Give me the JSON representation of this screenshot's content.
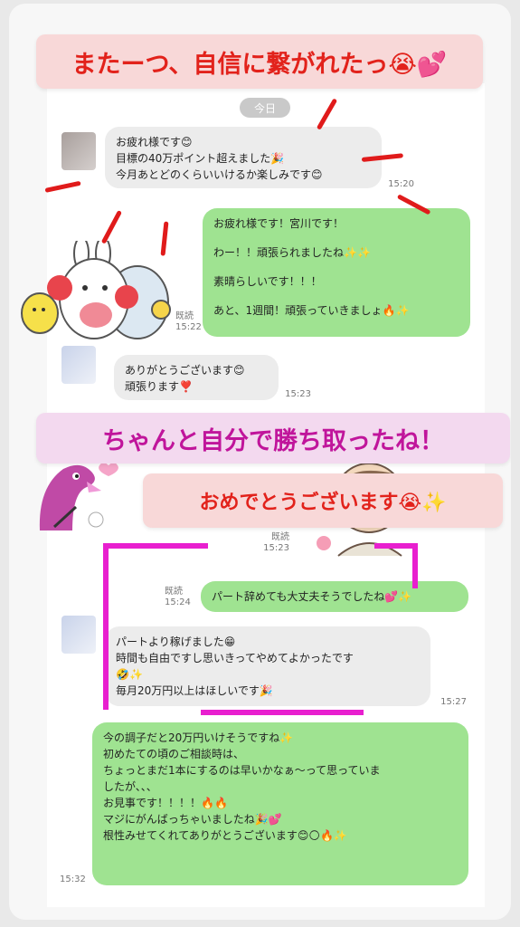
{
  "overlays": {
    "title1": "またーつ、自信に繋がれたっ😭💕",
    "title2": "ちゃんと自分で勝ち取ったね！",
    "title3": "おめでとうございます😭✨"
  },
  "date_label": "今日",
  "messages": {
    "m1": {
      "lines": [
        "お疲れ様です😊",
        "目標の40万ポイント超えました🎉",
        "今月あとどのくらいいけるか楽しみです😊"
      ],
      "time": "15:20"
    },
    "m2": {
      "lines": [
        "お疲れ様です！宮川です！",
        "わー！！頑張られましたね✨✨",
        "素晴らしいです！！！",
        "あと、1週間！頑張っていきましょ🔥✨"
      ],
      "read": "既読",
      "time": "15:22"
    },
    "m3": {
      "lines": [
        "ありがとうございます😊",
        "頑張ります❣️"
      ],
      "time": "15:23"
    },
    "m4": {
      "read": "既読",
      "time": "15:23"
    },
    "m5": {
      "text": "パート辞めても大丈夫そうでしたね💕✨",
      "read": "既読",
      "time": "15:24"
    },
    "m6": {
      "lines": [
        "パートより稼げました😁",
        "時間も自由ですし思いきってやめてよかったです",
        "🤣✨",
        "毎月20万円以上はほしいです🎉"
      ],
      "time": "15:27"
    },
    "m7": {
      "lines": [
        "今の調子だと20万円いけそうですね✨",
        "初めたての頃のご相談時は、",
        "ちょっとまだ1本にするのは早いかなぁ〜って思っていま",
        "したが、、、",
        "",
        "お見事です！！！！🔥🔥",
        "マジにがんばっちゃいましたね🎉💕",
        "",
        "根性みせてくれてありがとうございます😊🌕🔥✨"
      ],
      "time": "15:32"
    }
  },
  "stickers": {
    "bunny": "bunny-cheer-sticker",
    "creature": "pink-creature-sticker",
    "girl": "girl-sticker"
  }
}
